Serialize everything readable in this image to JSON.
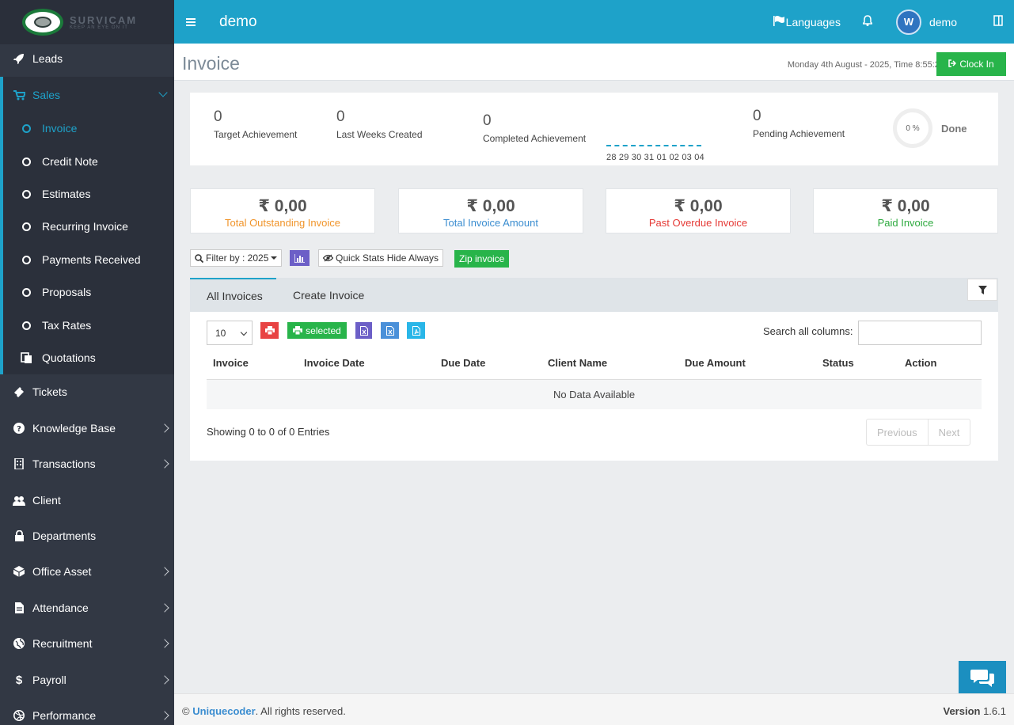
{
  "app": {
    "logo_title": "SURVICAM",
    "logo_tagline": "KEEP AN EYE ON IT",
    "brand": "demo"
  },
  "sidebar": {
    "items": [
      {
        "label": "Leads",
        "icon": "rocket-icon"
      },
      {
        "label": "Sales",
        "icon": "cart-icon"
      },
      {
        "label": "Tickets",
        "icon": "ticket-icon"
      },
      {
        "label": "Knowledge Base",
        "icon": "question-icon"
      },
      {
        "label": "Transactions",
        "icon": "building-icon"
      },
      {
        "label": "Client",
        "icon": "users-icon"
      },
      {
        "label": "Departments",
        "icon": "lock-icon"
      },
      {
        "label": "Office Asset",
        "icon": "cube-icon"
      },
      {
        "label": "Attendance",
        "icon": "file-icon"
      },
      {
        "label": "Recruitment",
        "icon": "globe-icon"
      },
      {
        "label": "Payroll",
        "icon": "dollar-icon"
      },
      {
        "label": "Performance",
        "icon": "dribbble-icon"
      }
    ],
    "sales_sub": [
      {
        "label": "Invoice"
      },
      {
        "label": "Credit Note"
      },
      {
        "label": "Estimates"
      },
      {
        "label": "Recurring Invoice"
      },
      {
        "label": "Payments Received"
      },
      {
        "label": "Proposals"
      },
      {
        "label": "Tax Rates"
      },
      {
        "label": "Quotations"
      }
    ]
  },
  "topbar": {
    "languages": "Languages",
    "avatar_letter": "W",
    "username": "demo"
  },
  "header": {
    "title": "Invoice",
    "date_line": "Monday 4th August - 2025,  Time  8:55:27",
    "clock_in": "Clock In"
  },
  "stats": {
    "target": {
      "value": "0",
      "label": "Target Achievement"
    },
    "last_weeks": {
      "value": "0",
      "label": "Last Weeks Created"
    },
    "completed": {
      "value": "0",
      "label": "Completed Achievement"
    },
    "pending": {
      "value": "0",
      "label": "Pending Achievement"
    },
    "days": "28 29 30 31 01 02 03 04",
    "done_percent": "0 %",
    "done_label": "Done"
  },
  "cards": [
    {
      "value": "₹ 0,00",
      "caption": "Total Outstanding Invoice",
      "color": "#f0942a"
    },
    {
      "value": "₹ 0,00",
      "caption": "Total Invoice Amount",
      "color": "#3b8dd0"
    },
    {
      "value": "₹ 0,00",
      "caption": "Past Overdue Invoice",
      "color": "#e53935"
    },
    {
      "value": "₹ 0,00",
      "caption": "Paid Invoice",
      "color": "#2eaa3f"
    }
  ],
  "toolbar": {
    "filter": "Filter by : 2025",
    "quick_stats": "Quick Stats Hide Always",
    "zip": "Zip invoice"
  },
  "tabs": [
    {
      "label": "All Invoices"
    },
    {
      "label": "Create Invoice"
    }
  ],
  "table": {
    "page_length": "10",
    "selected_label": "selected",
    "search_label": "Search all columns:",
    "columns": [
      "Invoice",
      "Invoice Date",
      "Due Date",
      "Client Name",
      "Due Amount",
      "Status",
      "Action"
    ],
    "empty": "No Data Available",
    "showing": "Showing 0 to 0 of 0 Entries",
    "prev": "Previous",
    "next": "Next"
  },
  "footer": {
    "copy": "© ",
    "company": "Uniquecoder",
    "rights": ". All rights reserved.",
    "version_label": "Version",
    "version": "1.6.1"
  },
  "colors": {
    "accent": "#1ea2c9",
    "sidebar": "#323844",
    "success": "#28b44a",
    "purple": "#6c5fc7",
    "danger": "#e53935"
  }
}
